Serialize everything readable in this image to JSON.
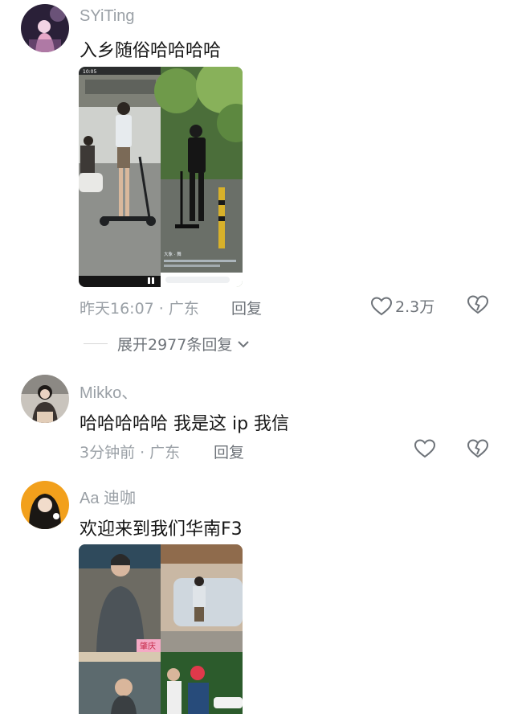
{
  "comments": [
    {
      "username": "SYiTing",
      "text": "入乡随俗哈哈哈哈",
      "time": "昨天16:07",
      "location": "广东",
      "reply_label": "回复",
      "like_count": "2.3万",
      "expand_label": "展开2977条回复",
      "media": {
        "left_status_time": "10:05",
        "right_overlay_text": "大象 · 舞"
      }
    },
    {
      "username": "Mikko、",
      "text": "哈哈哈哈哈 我是这 ip 我信",
      "time": "3分钟前",
      "location": "广东",
      "reply_label": "回复"
    },
    {
      "username": "Aa 迪咖",
      "text": "欢迎来到我们华南F3",
      "media": {
        "sign_text": "肇庆"
      }
    }
  ]
}
